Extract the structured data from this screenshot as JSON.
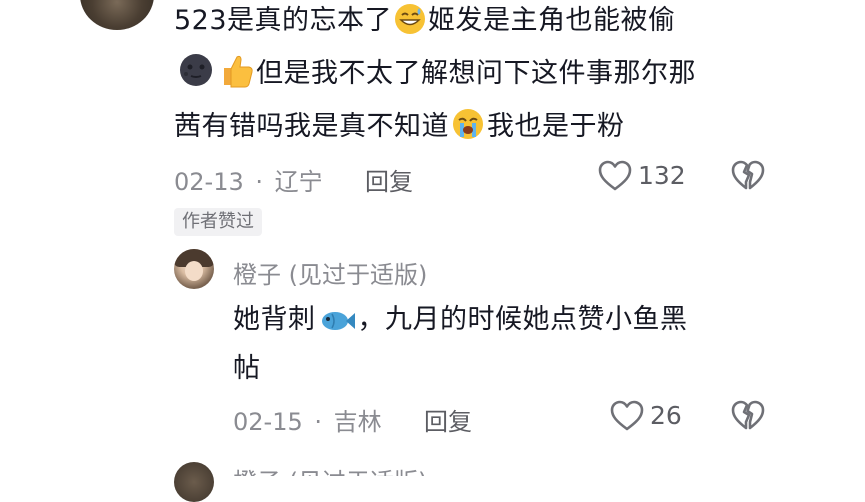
{
  "comment": {
    "line1_a": "523是真的忘本了",
    "line1_b": "姬发是主角也能被偷",
    "line2": "但是我不太了解想问下这件事那尔那",
    "line3_a": "茜有错吗我是真不知道",
    "line3_b": "我也是于粉",
    "date": "02-13",
    "separator": "·",
    "location": "辽宁",
    "reply_label": "回复",
    "like_count": "132",
    "author_badge": "作者赞过"
  },
  "reply": {
    "username": "橙子 (见过于适版)",
    "line1_a": "她背刺",
    "line1_b": "，九月的时候她点赞小鱼黑",
    "line2": "帖",
    "date": "02-15",
    "separator": "·",
    "location": "吉林",
    "reply_label": "回复",
    "like_count": "26"
  },
  "next_reply": {
    "username_partial": "橙子 (见过于适版)"
  },
  "icons": {
    "like": "heart-outline-icon",
    "dislike": "broken-heart-icon",
    "emoji_grin": "grinning-sweat-emoji",
    "emoji_moon": "new-moon-face-emoji",
    "emoji_thumbs": "thumbs-up-emoji",
    "emoji_cry": "loudly-crying-emoji",
    "emoji_fish": "fish-emoji"
  },
  "colors": {
    "text_primary": "#161823",
    "text_secondary": "#8a8b91",
    "badge_bg": "#f1f1f3"
  }
}
